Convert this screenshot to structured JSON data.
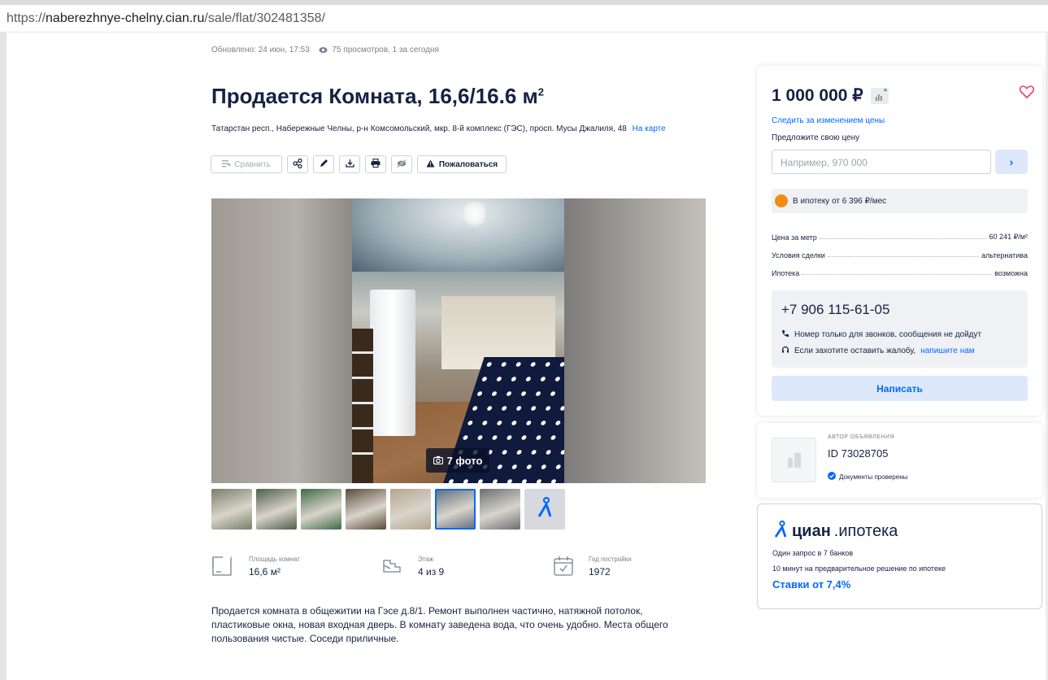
{
  "browser": {
    "url_scheme": "https://",
    "url_host": "naberezhnye-chelny.cian.ru",
    "url_path": "/sale/flat/302481358/"
  },
  "meta": {
    "updated": "Обновлено: 24 июн, 17:53",
    "views": "75 просмотров, 1 за сегодня"
  },
  "listing": {
    "title": "Продается Комната, 16,6/16.6 м",
    "title_sup": "2",
    "address": "Татарстан респ., Набережные Челны, р-н Комсомольский, мкр. 8-й комплекс (ГЭС), просп. Мусы Джалиля, 48",
    "map_link": "На карте"
  },
  "toolbar": {
    "compare": "Сравнить",
    "report": "Пожаловаться",
    "icons": [
      "share-icon",
      "edit-icon",
      "download-icon",
      "print-icon",
      "hide-icon"
    ]
  },
  "gallery": {
    "photo_count": "7 фото",
    "thumbnail_colors": [
      "#7a7f6a",
      "#4f5e4a",
      "#3f6a46",
      "#5b4a3a",
      "#b5a58f",
      "#5c6b7c",
      "#6a6e73"
    ],
    "selected_thumbnail": 6
  },
  "facts": [
    {
      "label": "Площадь комнат",
      "value": "16,6 м²",
      "icon": "area-icon"
    },
    {
      "label": "Этаж",
      "value": "4 из 9",
      "icon": "stairs-icon"
    },
    {
      "label": "Год постройки",
      "value": "1972",
      "icon": "calendar-icon"
    }
  ],
  "description": "Продается комната в общежитии на Гэсе д.8/1. Ремонт выполнен частично, натяжной потолок, пластиковые окна, новая входная дверь. В комнату заведена вода, что очень удобно. Места общего пользования чистые. Соседи приличные.",
  "price_card": {
    "price": "1 000 000 ₽",
    "follow_price": "Следить за изменением цены",
    "offer_label": "Предложите свою цену",
    "offer_placeholder": "Например, 970 000",
    "mortgage": "В ипотеку от 6 396 ₽/мес",
    "details": [
      {
        "key": "Цена за метр",
        "value": "60 241 ₽/м²"
      },
      {
        "key": "Условия сделки",
        "value": "альтернатива"
      },
      {
        "key": "Ипотека",
        "value": "возможна"
      }
    ],
    "phone": "+7 906 115-61-05",
    "phone_note": "Номер только для звонков, сообщения не дойдут",
    "complaint_text": "Если захотите оставить жалобу,",
    "complaint_link": "напишите нам",
    "write_button": "Написать"
  },
  "author": {
    "label": "АВТОР ОБЪЯВЛЕНИЯ",
    "id": "ID 73028705",
    "verified": "Документы проверены"
  },
  "cian_mortgage": {
    "brand": "циан",
    "brand_suffix": ".ипотека",
    "line1": "Один запрос в 7 банков",
    "line2": "10 минут на предварительное решение по ипотеке",
    "rates": "Ставки от 7,4%"
  },
  "colors": {
    "accent": "#0468ff",
    "text": "#152242",
    "mortgage_orange": "#f28c13",
    "heart": "#e84260"
  }
}
